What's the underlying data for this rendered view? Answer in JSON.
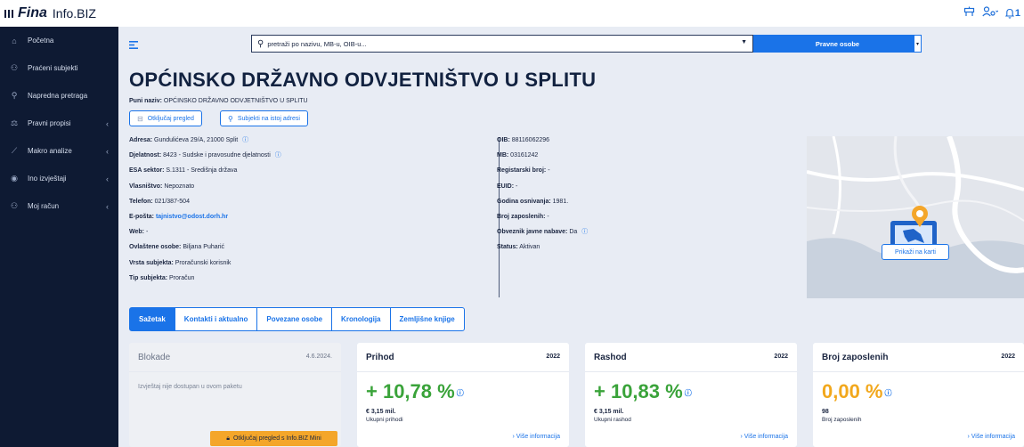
{
  "header": {
    "brand": "Fina",
    "product": "Info.BIZ",
    "notifications_count": "1"
  },
  "sidebar": {
    "items": [
      {
        "label": "Početna",
        "icon": "home-icon"
      },
      {
        "label": "Praćeni subjekti",
        "icon": "users-icon"
      },
      {
        "label": "Napredna pretraga",
        "icon": "search-icon"
      },
      {
        "label": "Pravni propisi",
        "icon": "gavel-icon"
      },
      {
        "label": "Makro analize",
        "icon": "chart-icon"
      },
      {
        "label": "Ino izvještaji",
        "icon": "globe-icon"
      },
      {
        "label": "Moj račun",
        "icon": "user-icon"
      }
    ]
  },
  "search": {
    "placeholder": "pretraži po nazivu, MB-u, OIB-u...",
    "scope": "Pravne osobe"
  },
  "entity": {
    "title": "OPĆINSKO DRŽAVNO ODVJETNIŠTVO U SPLITU",
    "fullname_label": "Puni naziv:",
    "fullname_value": "OPĆINSKO DRŽAVNO ODVJETNIŠTVO U SPLITU",
    "unlock_button": "Otključaj pregled",
    "same_address_button": "Subjekti na istoj adresi",
    "left_fields": [
      {
        "label": "Adresa:",
        "value": "Gundulićeva 29/A, 21000 Split"
      },
      {
        "label": "Djelatnost:",
        "value": "8423 - Sudske i pravosudne djelatnosti"
      },
      {
        "label": "ESA sektor:",
        "value": "S.1311 - Središnja država"
      },
      {
        "label": "Vlasništvo:",
        "value": "Nepoznato"
      },
      {
        "label": "Telefon:",
        "value": "021/387-504"
      },
      {
        "label": "E-pošta:",
        "value": "tajnistvo@odost.dorh.hr"
      },
      {
        "label": "Web:",
        "value": "-"
      },
      {
        "label": "Ovlaštene osobe:",
        "value": "Biljana Puharić"
      },
      {
        "label": "Vrsta subjekta:",
        "value": "Proračunski korisnik"
      },
      {
        "label": "Tip subjekta:",
        "value": "Proračun"
      }
    ],
    "right_fields": [
      {
        "label": "OIB:",
        "value": "88116062296"
      },
      {
        "label": "MB:",
        "value": "03161242"
      },
      {
        "label": "Registarski broj:",
        "value": "-"
      },
      {
        "label": "EUID:",
        "value": "-"
      },
      {
        "label": "Godina osnivanja:",
        "value": "1981."
      },
      {
        "label": "Broj zaposlenih:",
        "value": "-"
      },
      {
        "label": "Obveznik javne nabave:",
        "value": "Da"
      },
      {
        "label": "Status:",
        "value": "Aktivan"
      }
    ],
    "map_button": "Prikaži na karti"
  },
  "tabs": [
    "Sažetak",
    "Kontakti i aktualno",
    "Povezane osobe",
    "Kronologija",
    "Zemljišne knjige"
  ],
  "cards": {
    "blokade": {
      "title": "Blokade",
      "date": "4.6.2024.",
      "message": "Izvještaj nije dostupan u ovom paketu",
      "button": "Otključaj pregled s Info.BIZ Mini"
    },
    "prihod": {
      "title": "Prihod",
      "year": "2022",
      "value": "+ 10,78 %",
      "amount": "€ 3,15 mil.",
      "caption": "Ukupni prihodi",
      "more": "Više informacija"
    },
    "rashod": {
      "title": "Rashod",
      "year": "2022",
      "value": "+ 10,83 %",
      "amount": "€ 3,15 mil.",
      "caption": "Ukupni rashod",
      "more": "Više informacija"
    },
    "zaposleni": {
      "title": "Broj zaposlenih",
      "year": "2022",
      "value": "0,00 %",
      "amount": "98",
      "caption": "Broj zaposlenih",
      "more": "Više informacija"
    }
  },
  "colors": {
    "sidebar": "#0e1a33",
    "accent": "#1a73e8",
    "positive": "#3aa33a",
    "neutral": "#f2a81d",
    "warning_button": "#f4a62a"
  }
}
